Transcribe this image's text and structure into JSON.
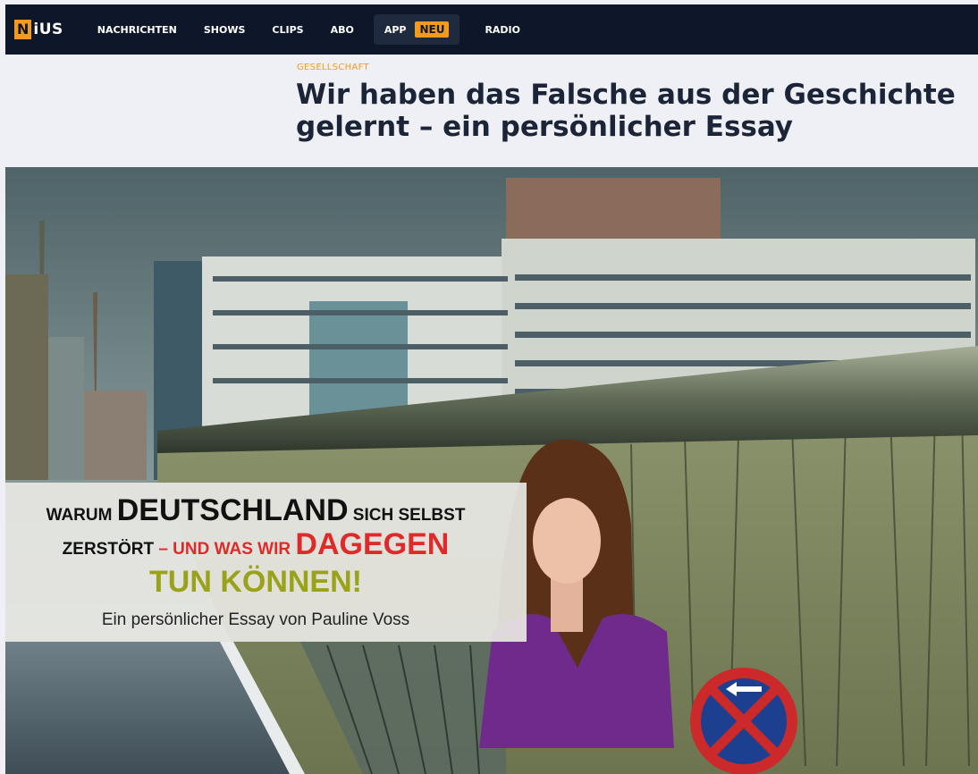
{
  "nav": {
    "logo_badge": "N",
    "logo_rest": "iUS",
    "items": [
      "NACHRICHTEN",
      "SHOWS",
      "CLIPS",
      "ABO"
    ],
    "app_label": "APP",
    "app_badge": "NEU",
    "radio_label": "RADIO"
  },
  "article": {
    "category": "GESELLSCHAFT",
    "headline": "Wir haben das Falsche aus der Geschichte gelernt – ein persönlicher Essay"
  },
  "banner": {
    "line1_a": "WARUM ",
    "line1_b": "DEUTSCHLAND",
    "line1_c": " SICH SELBST",
    "line2_a": "ZERSTÖRT",
    "line2_b": " – UND WAS WIR ",
    "line2_c": "DAGEGEN",
    "line3": "TUN KÖNNEN!",
    "line4": "Ein persönlicher Essay von Pauline Voss"
  },
  "colors": {
    "nav_bg": "#0d1729",
    "accent": "#f29a1d",
    "headline": "#1c2538",
    "banner_red": "#e02a2a",
    "banner_green": "#9aa21a"
  },
  "icons": {
    "logo": "nius-logo",
    "sign": "no-stopping-sign"
  }
}
